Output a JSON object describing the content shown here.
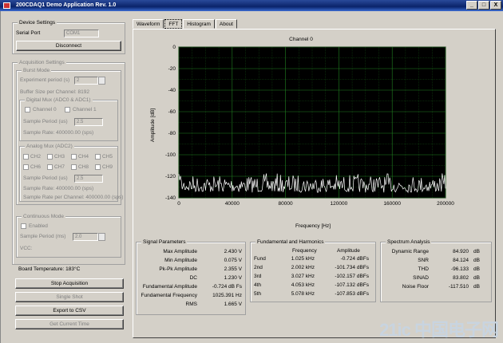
{
  "window": {
    "title": "200CDAQ1 Demo Application Rev. 1.0",
    "min": "_",
    "max": "□",
    "close": "X"
  },
  "device": {
    "legend": "Device Settings",
    "serial_label": "Serial Port",
    "serial_value": "COM1",
    "disconnect": "Disconnect"
  },
  "acq": {
    "legend": "Acquisition Settings",
    "burst_legend": "Burst Mode",
    "exp_label": "Experiment period (s)",
    "exp_value": "2",
    "buffer_label": "Buffer Size per Channel: 8192",
    "dmux_legend": "Digital Mux (ADC0 & ADC1)",
    "ch0": "Channel 0",
    "ch1": "Channel 1",
    "sp_label": "Sample Period (us)",
    "sp_value": "2.5",
    "rate1": "Sample Rate: 400000.00 (sps)",
    "amux_legend": "Analog Mux (ADC2)",
    "ch_row1": [
      "CH2",
      "CH3",
      "CH4",
      "CH5"
    ],
    "ch_row2": [
      "CH6",
      "CH7",
      "CH8",
      "CH9"
    ],
    "sp2_label": "Sample Period (us)",
    "sp2_value": "2.5",
    "rate2": "Sample Rate: 400000.00 (sps)",
    "rate3": "Sample Rate per Channel: 400000.00 (sps)",
    "cont_legend": "Continuous Mode",
    "enabled": "Enabled",
    "sp3_label": "Sample Period (ms)",
    "sp3_value": "2.0",
    "vcc": "VCC:"
  },
  "board_temp": "Board Temperature: 183°C",
  "buttons": {
    "stop": "Stop Acquisition",
    "single": "Single Shot",
    "export": "Export to CSV",
    "time": "Get Current Time"
  },
  "tabs": [
    "Waveform",
    "FFT",
    "Histogram",
    "About"
  ],
  "chart_data": {
    "type": "line",
    "title": "Channel 0",
    "xlabel": "Frequency [Hz]",
    "ylabel": "Amplitude [dB]",
    "xlim": [
      0,
      200000
    ],
    "ylim": [
      -140,
      0
    ],
    "xticks": [
      "0",
      "40000",
      "80000",
      "120000",
      "160000",
      "200000"
    ],
    "yticks": [
      "0",
      "-20",
      "-40",
      "-60",
      "-80",
      "-100",
      "-120",
      "-140"
    ],
    "series": [
      {
        "noise_floor_db": -122
      }
    ],
    "background": "#000000",
    "grid": true,
    "grid_color": "#208020",
    "line_color": "#ffffff"
  },
  "signal": {
    "legend": "Signal Parameters",
    "rows": [
      {
        "label": "Max Amplitude",
        "value": "2.430 V"
      },
      {
        "label": "Min Amplitude",
        "value": "0.075 V"
      },
      {
        "label": "Pk-Pk Amplitude",
        "value": "2.355 V"
      },
      {
        "label": "DC",
        "value": "1.230 V"
      },
      {
        "label": "Fundamental Amplitude",
        "value": "-0.724 dB Fs"
      },
      {
        "label": "Fundamental Frequency",
        "value": "1025.391 Hz"
      },
      {
        "label": "RMS",
        "value": "1.665 V"
      }
    ]
  },
  "harm": {
    "legend": "Fundamental and Harmonics",
    "col1": "Frequency",
    "col2": "Amplitude",
    "rows": [
      {
        "label": "Fund",
        "freq": "1.025 kHz",
        "amp": "-0.724 dBFs"
      },
      {
        "label": "2nd",
        "freq": "2.002 kHz",
        "amp": "-101.734 dBFs"
      },
      {
        "label": "3rd",
        "freq": "3.027 kHz",
        "amp": "-102.157 dBFs"
      },
      {
        "label": "4th",
        "freq": "4.053 kHz",
        "amp": "-107.132 dBFs"
      },
      {
        "label": "5th",
        "freq": "5.078 kHz",
        "amp": "-107.853 dBFs"
      }
    ]
  },
  "spectrum": {
    "legend": "Spectrum Analysis",
    "rows": [
      {
        "label": "Dynamic Range",
        "value": "84.920",
        "unit": "dB"
      },
      {
        "label": "SNR",
        "value": "84.124",
        "unit": "dB"
      },
      {
        "label": "THD",
        "value": "-96.133",
        "unit": "dB"
      },
      {
        "label": "SINAD",
        "value": "83.802",
        "unit": "dB"
      },
      {
        "label": "Noise Floor",
        "value": "-117.510",
        "unit": "dB"
      }
    ]
  },
  "watermark": "21ic 中国电子网"
}
